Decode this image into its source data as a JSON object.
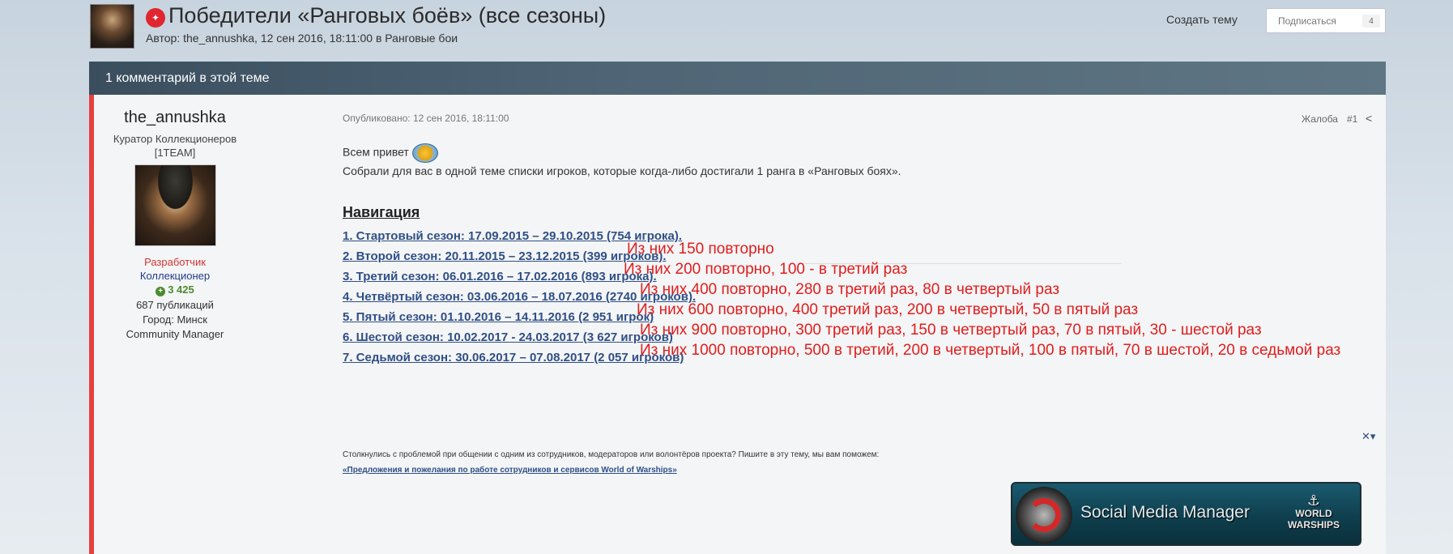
{
  "header": {
    "pin_icon": "pin-icon",
    "title": "Победители «Ранговых боёв» (все сезоны)",
    "meta": "Автор: the_annushka, 12 сен 2016, 18:11:00 в Ранговые бои",
    "create_topic": "Создать тему",
    "subscribe_label": "Подписаться",
    "subscribe_count": "4"
  },
  "comments_bar": {
    "text": "1 комментарий в этой теме"
  },
  "author": {
    "name": "the_annushka",
    "title": "Куратор Коллекционеров [1TEAM]",
    "group1": "Разработчик",
    "group2": "Коллекционер",
    "reputation": "3 425",
    "posts": "687 публикаций",
    "city": "Город: Минск",
    "role": "Community Manager"
  },
  "post": {
    "date": "Опубликовано: 12 сен 2016, 18:11:00",
    "report": "Жалоба",
    "number": "#1",
    "greeting": "Всем привет",
    "intro": "Собрали для вас в одной теме списки игроков, которые когда-либо достигали 1 ранга в «Ранговых боях».",
    "nav_heading": "Навигация",
    "nav_items": [
      "1. Стартовый сезон: 17.09.2015 – 29.10.2015 (754 игрока).",
      "2. Второй сезон: 20.11.2015 – 23.12.2015 (399 игроков).",
      "3. Третий сезон: 06.01.2016 – 17.02.2016 (893 игрока).",
      "4. Четвёртый сезон: 03.06.2016 – 18.07.2016 (2740 игроков).",
      "5. Пятый сезон: 01.10.2016 – 14.11.2016 (2 951 игрок)",
      "6. Шестой сезон: 10.02.2017 - 24.03.2017 (3 627 игроков)",
      "7. Седьмой сезон: 30.06.2017 – 07.08.2017 (2 057 игроков)"
    ],
    "notes": [
      "Из них 150 повторно",
      "Из них 200 повторно, 100 - в третий раз",
      "Из них 400 повторно, 280 в третий раз, 80 в четвертый раз",
      "Из них 600 повторно, 400 третий раз, 200 в четвертый, 50 в пятый раз",
      "Из них 900 повторно, 300 третий раз, 150 в четвертый раз, 70 в пятый, 30 - шестой раз",
      "Из них 1000 повторно, 500 в третий, 200 в четвертый, 100 в пятый, 70 в шестой, 20 в седьмой раз"
    ],
    "footer_text": "Столкнулись с проблемой при общении с одним из сотрудников, модераторов или волонтёров проекта? Пишите в эту тему, мы вам поможем:",
    "footer_link": "«Предложения и пожелания по работе сотрудников и сервисов World of Warships»"
  },
  "banner": {
    "text": "Social Media Manager",
    "brand_line1": "WORLD",
    "brand_line2": "WARSHIPS",
    "brand_line1_of": "OF"
  }
}
